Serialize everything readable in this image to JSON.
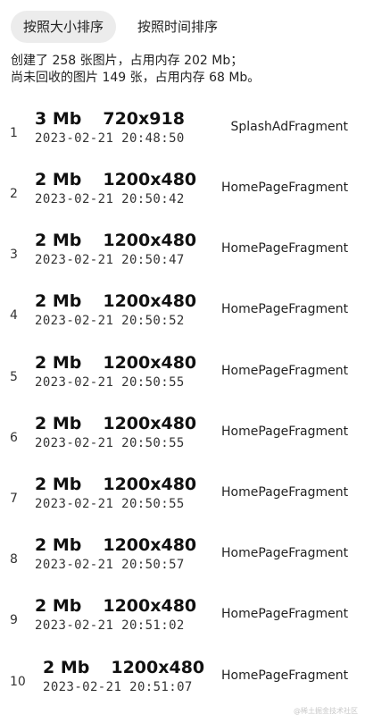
{
  "tabs": [
    {
      "label": "按照大小排序",
      "active": true
    },
    {
      "label": "按照时间排序",
      "active": false
    }
  ],
  "summary": {
    "line1": "创建了 258 张图片，占用内存 202 Mb；",
    "line2": "尚未回收的图片 149 张，占用内存 68 Mb。"
  },
  "rows": [
    {
      "index": "1",
      "size": "3 Mb",
      "dims": "720x918",
      "time": "2023-02-21 20:48:50",
      "fragment": "SplashAdFragment"
    },
    {
      "index": "2",
      "size": "2 Mb",
      "dims": "1200x480",
      "time": "2023-02-21 20:50:42",
      "fragment": "HomePageFragment"
    },
    {
      "index": "3",
      "size": "2 Mb",
      "dims": "1200x480",
      "time": "2023-02-21 20:50:47",
      "fragment": "HomePageFragment"
    },
    {
      "index": "4",
      "size": "2 Mb",
      "dims": "1200x480",
      "time": "2023-02-21 20:50:52",
      "fragment": "HomePageFragment"
    },
    {
      "index": "5",
      "size": "2 Mb",
      "dims": "1200x480",
      "time": "2023-02-21 20:50:55",
      "fragment": "HomePageFragment"
    },
    {
      "index": "6",
      "size": "2 Mb",
      "dims": "1200x480",
      "time": "2023-02-21 20:50:55",
      "fragment": "HomePageFragment"
    },
    {
      "index": "7",
      "size": "2 Mb",
      "dims": "1200x480",
      "time": "2023-02-21 20:50:55",
      "fragment": "HomePageFragment"
    },
    {
      "index": "8",
      "size": "2 Mb",
      "dims": "1200x480",
      "time": "2023-02-21 20:50:57",
      "fragment": "HomePageFragment"
    },
    {
      "index": "9",
      "size": "2 Mb",
      "dims": "1200x480",
      "time": "2023-02-21 20:51:02",
      "fragment": "HomePageFragment"
    },
    {
      "index": "10",
      "size": "2 Mb",
      "dims": "1200x480",
      "time": "2023-02-21 20:51:07",
      "fragment": "HomePageFragment"
    }
  ],
  "watermark": "@稀土掘金技术社区"
}
